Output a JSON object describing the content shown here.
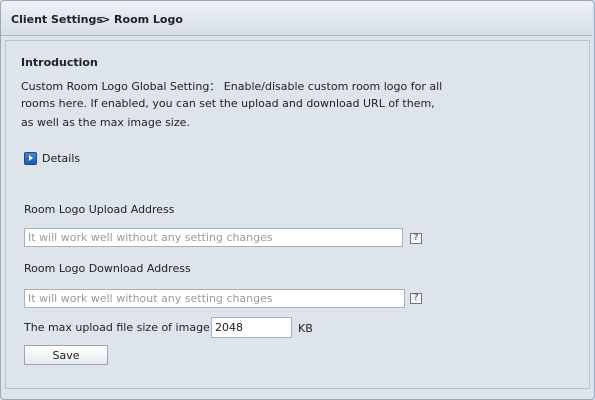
{
  "header": {
    "breadcrumb_root": "Client Settings",
    "breadcrumb_current": "> Room Logo"
  },
  "intro": {
    "title": "Introduction",
    "lines": [
      "Custom Room Logo Global Setting： Enable/disable custom room logo for all",
      "rooms here. If enabled, you can set the upload and download URL of them,",
      "as well as the max image size."
    ],
    "details_label": "Details"
  },
  "form": {
    "upload": {
      "label": "Room Logo Upload Address",
      "value": "",
      "placeholder": "It will work well without any setting changes",
      "help": "?"
    },
    "download": {
      "label": "Room Logo Download Address",
      "value": "",
      "placeholder": "It will work well without any setting changes",
      "help": "?"
    },
    "max_size": {
      "label": "The max upload file size of image",
      "value": "2048",
      "unit": "KB"
    },
    "save_label": "Save"
  },
  "icons": {
    "details": "play-arrow-icon",
    "help": "question-mark-icon"
  }
}
